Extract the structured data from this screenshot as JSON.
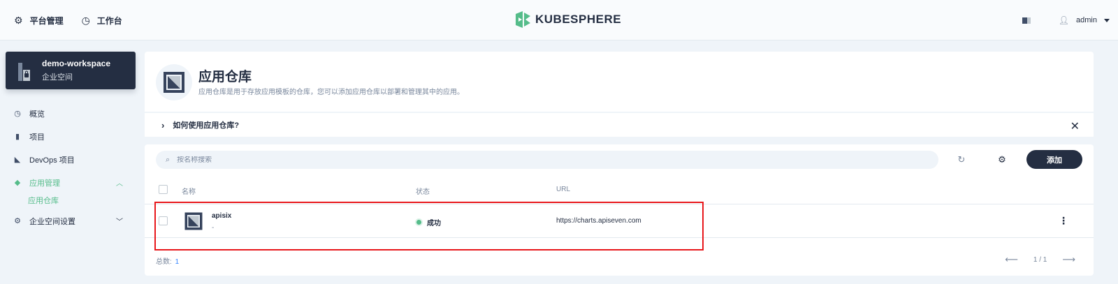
{
  "topbar": {
    "nav": [
      {
        "label": "平台管理",
        "icon": "gear-icon"
      },
      {
        "label": "工作台",
        "icon": "dashboard-icon"
      }
    ],
    "brand": "KUBESPHERE",
    "user": "admin"
  },
  "workspace": {
    "name": "demo-workspace",
    "type": "企业空间"
  },
  "sidebar": {
    "items": [
      {
        "label": "概览",
        "icon": "dashboard-icon"
      },
      {
        "label": "项目",
        "icon": "project-icon"
      },
      {
        "label": "DevOps 项目",
        "icon": "devops-icon"
      },
      {
        "label": "应用管理",
        "icon": "layers-icon",
        "active": true
      },
      {
        "label": "企业空间设置",
        "icon": "gear-icon"
      }
    ],
    "sub_item": "应用仓库"
  },
  "banner": {
    "title": "应用仓库",
    "description": "应用仓库是用于存放应用模板的仓库，您可以添加应用仓库以部署和管理其中的应用。"
  },
  "howto": {
    "label": "如何使用应用仓库?"
  },
  "toolbar": {
    "search_placeholder": "按名称搜索",
    "add_label": "添加"
  },
  "table": {
    "columns": [
      "名称",
      "状态",
      "URL"
    ],
    "rows": [
      {
        "name": "apisix",
        "desc": "-",
        "status": "成功",
        "url": "https://charts.apiseven.com"
      }
    ]
  },
  "footer": {
    "total_label": "总数:",
    "total_value": "1",
    "page": "1 / 1"
  },
  "colors": {
    "accent": "#55bc8a",
    "dark": "#242e42",
    "highlight": "#e8171b"
  }
}
